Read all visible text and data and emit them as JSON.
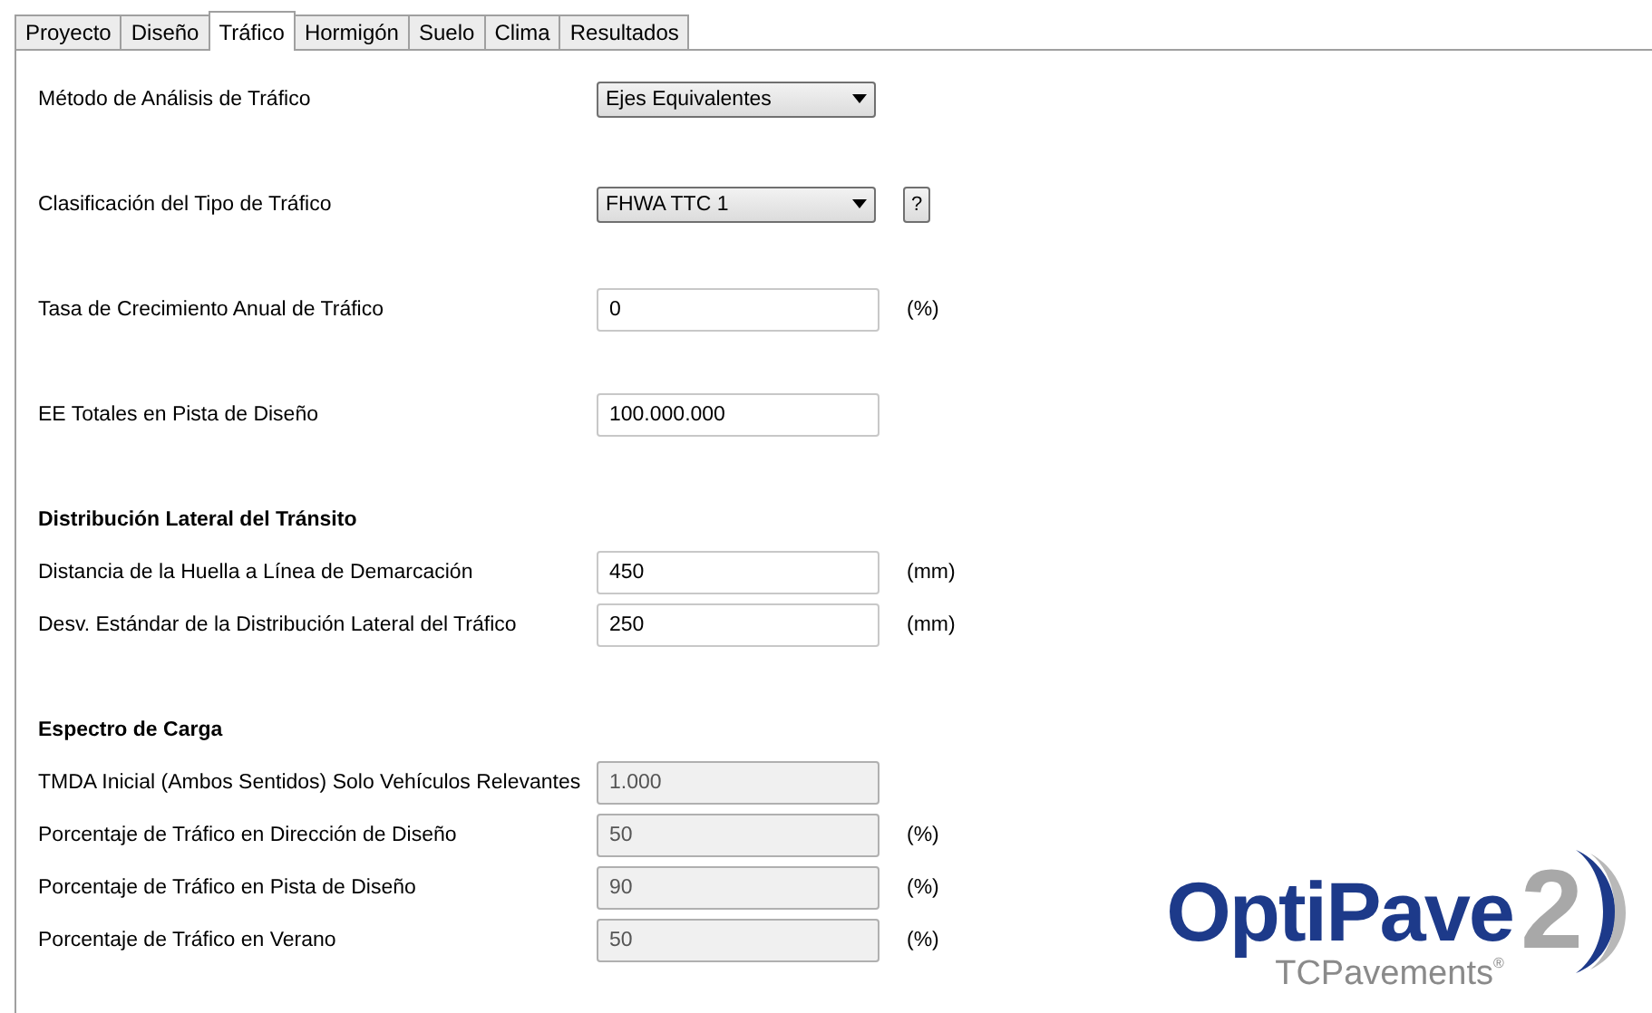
{
  "tabs": [
    {
      "label": "Proyecto",
      "selected": false
    },
    {
      "label": "Diseño",
      "selected": false
    },
    {
      "label": "Tráfico",
      "selected": true
    },
    {
      "label": "Hormigón",
      "selected": false
    },
    {
      "label": "Suelo",
      "selected": false
    },
    {
      "label": "Clima",
      "selected": false
    },
    {
      "label": "Resultados",
      "selected": false
    }
  ],
  "sections": [
    {
      "rows": [
        {
          "kind": "dropdown",
          "label": "Método de Análisis de Tráfico",
          "value": "Ejes Equivalentes"
        }
      ]
    },
    {
      "rows": [
        {
          "kind": "dropdown",
          "label": "Clasificación del Tipo de Tráfico",
          "value": "FHWA TTC 1",
          "help": "?"
        }
      ]
    },
    {
      "rows": [
        {
          "kind": "input",
          "label": "Tasa de Crecimiento Anual de Tráfico",
          "value": "0",
          "unit": "(%)",
          "disabled": false
        }
      ]
    },
    {
      "rows": [
        {
          "kind": "input",
          "label": "EE Totales en Pista de Diseño",
          "value": "100.000.000",
          "disabled": false
        }
      ]
    },
    {
      "title": "Distribución Lateral del Tránsito",
      "rows": [
        {
          "kind": "input",
          "label": "Distancia de la Huella a Línea de Demarcación",
          "value": "450",
          "unit": "(mm)",
          "disabled": false
        },
        {
          "kind": "input",
          "label": "Desv. Estándar de la Distribución Lateral del Tráfico",
          "value": "250",
          "unit": "(mm)",
          "disabled": false
        }
      ]
    },
    {
      "title": "Espectro de Carga",
      "rows": [
        {
          "kind": "input",
          "label": "TMDA Inicial (Ambos Sentidos) Solo Vehículos Relevantes",
          "value": "1.000",
          "disabled": true
        },
        {
          "kind": "input",
          "label": "Porcentaje de Tráfico en Dirección de Diseño",
          "value": "50",
          "unit": "(%)",
          "disabled": true
        },
        {
          "kind": "input",
          "label": "Porcentaje de Tráfico en Pista de Diseño",
          "value": "90",
          "unit": "(%)",
          "disabled": true
        },
        {
          "kind": "input",
          "label": "Porcentaje de Tráfico en Verano",
          "value": "50",
          "unit": "(%)",
          "disabled": true
        }
      ]
    }
  ],
  "logo": {
    "name": "OptiPave",
    "number": "2",
    "company": "TCPavements",
    "mark": "®"
  }
}
